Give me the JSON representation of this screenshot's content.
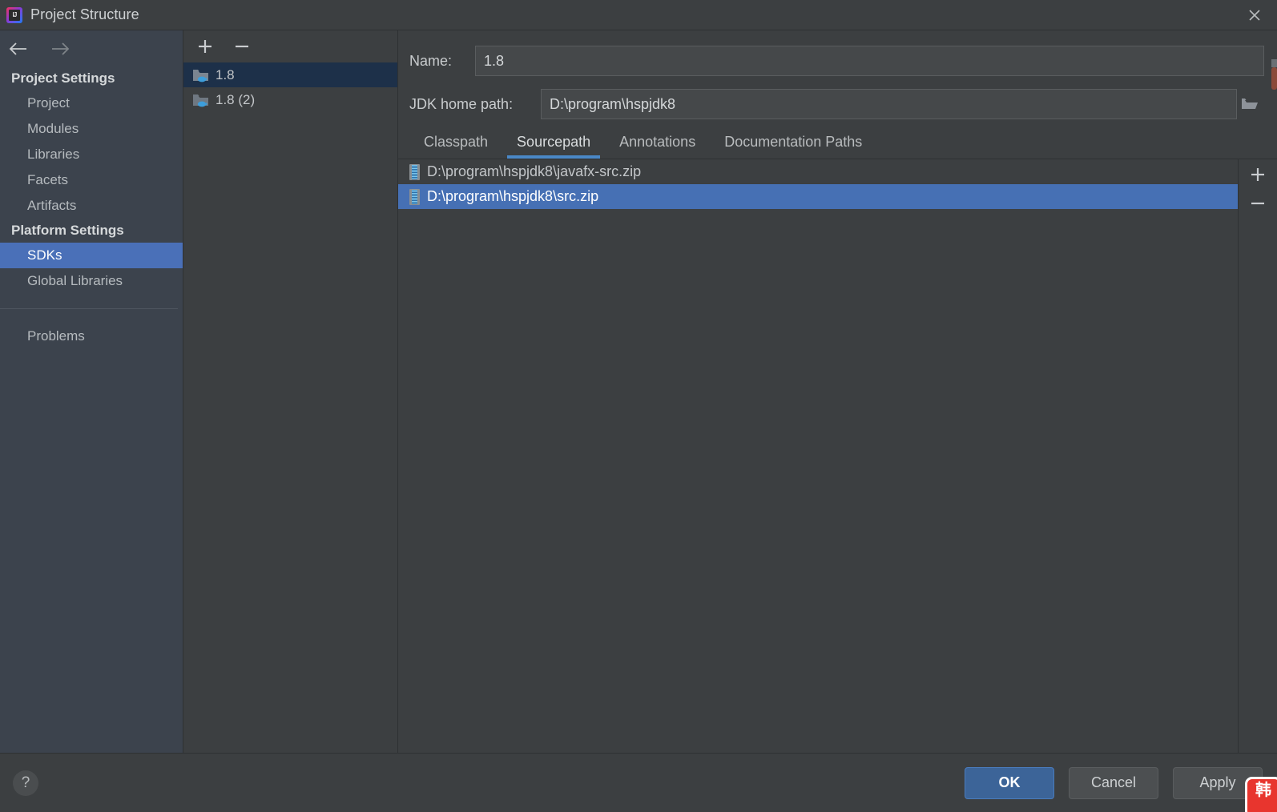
{
  "window": {
    "title": "Project Structure",
    "app_icon": "intellij-idea-icon",
    "close_label": "✕"
  },
  "nav": {
    "back_icon": "arrow-left-icon",
    "forward_icon": "arrow-right-icon"
  },
  "sidebar": {
    "groups": [
      {
        "title": "Project Settings",
        "items": [
          {
            "label": "Project",
            "selected": false
          },
          {
            "label": "Modules",
            "selected": false
          },
          {
            "label": "Libraries",
            "selected": false
          },
          {
            "label": "Facets",
            "selected": false
          },
          {
            "label": "Artifacts",
            "selected": false
          }
        ]
      },
      {
        "title": "Platform Settings",
        "items": [
          {
            "label": "SDKs",
            "selected": true
          },
          {
            "label": "Global Libraries",
            "selected": false
          }
        ]
      }
    ],
    "extra_items": [
      {
        "label": "Problems",
        "selected": false
      }
    ]
  },
  "sdk_list": {
    "toolbar": {
      "add_label": "+",
      "remove_label": "−"
    },
    "items": [
      {
        "label": "1.8",
        "selected": true
      },
      {
        "label": "1.8 (2)",
        "selected": false
      }
    ]
  },
  "detail": {
    "name": {
      "label": "Name:",
      "value": "1.8",
      "placeholder": ""
    },
    "jdk_home": {
      "label": "JDK home path:",
      "value": "D:\\program\\hspjdk8",
      "placeholder": "",
      "browse_icon": "folder-open-icon"
    },
    "tabs": [
      {
        "label": "Classpath",
        "active": false
      },
      {
        "label": "Sourcepath",
        "active": true
      },
      {
        "label": "Annotations",
        "active": false
      },
      {
        "label": "Documentation Paths",
        "active": false
      }
    ],
    "paths": [
      {
        "label": "D:\\program\\hspjdk8\\javafx-src.zip",
        "selected": false
      },
      {
        "label": "D:\\program\\hspjdk8\\src.zip",
        "selected": true
      }
    ],
    "path_toolbar": {
      "add_label": "+",
      "remove_label": "−"
    }
  },
  "footer": {
    "help_label": "?",
    "buttons": [
      {
        "label": "OK",
        "primary": true
      },
      {
        "label": "Cancel",
        "primary": false
      },
      {
        "label": "Apply",
        "primary": false
      }
    ]
  },
  "overlay": {
    "ime_badge_text": "韩",
    "accent_blue": "#4a88c7",
    "selection_blue": "#4670b4",
    "sidebar_selection_blue": "#4a70b8",
    "panel_bg": "#3c3f41",
    "sidebar_bg": "#3c434d",
    "sdk_selected_bg": "#1d3049",
    "ime_badge_red": "#e8352e"
  }
}
